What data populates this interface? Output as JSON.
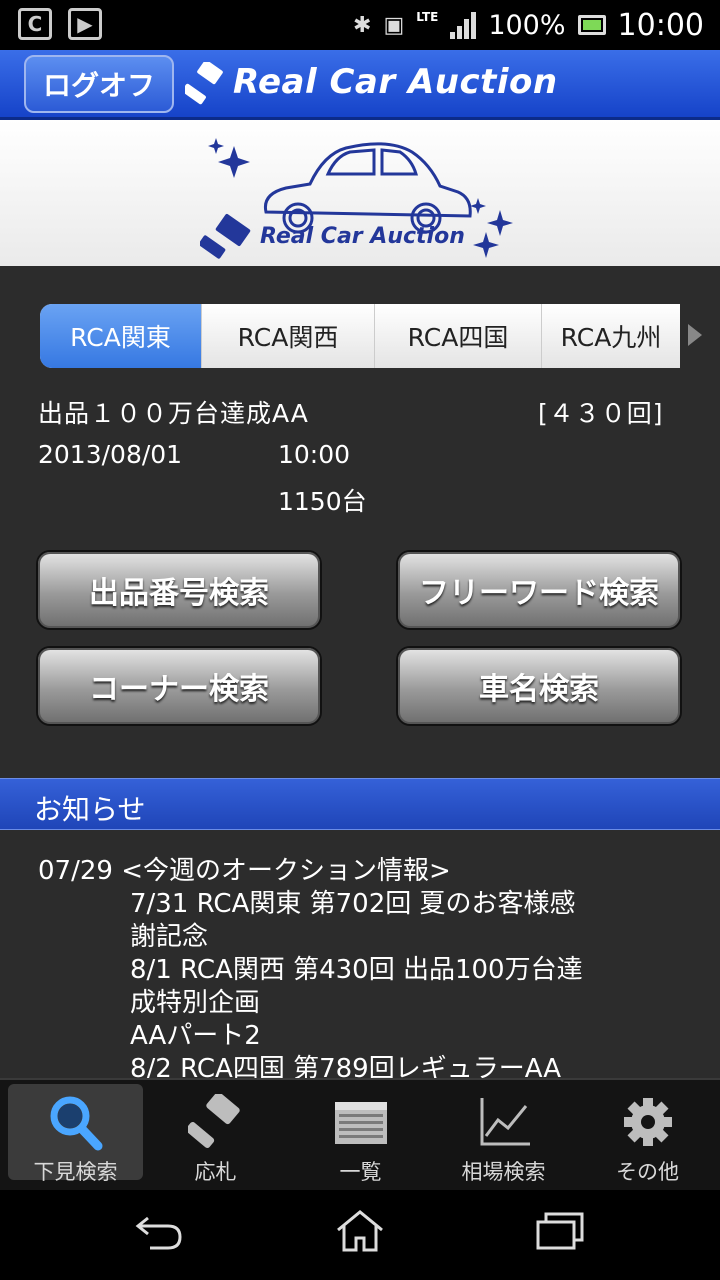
{
  "status_bar": {
    "left_icons": [
      "c-notification-icon",
      "play-store-icon"
    ],
    "right_icons": [
      "bluetooth-icon",
      "vibrate-icon",
      "lte-signal-icon",
      "battery-icon"
    ],
    "network": "LTE",
    "battery": "100%",
    "time": "10:00"
  },
  "header": {
    "logoff_label": "ログオフ",
    "title": "Real Car Auction",
    "color": "#1f4fd4"
  },
  "banner": {
    "title": "Real Car Auction"
  },
  "tabs": [
    {
      "label": "RCA関東",
      "active": true
    },
    {
      "label": "RCA関西",
      "active": false
    },
    {
      "label": "RCA四国",
      "active": false
    },
    {
      "label": "RCA九州",
      "active": false
    }
  ],
  "auction": {
    "name": "出品１００万台達成AA",
    "round": "[４３０回]",
    "date": "2013/08/01",
    "time": "10:00",
    "count": "1150台"
  },
  "search_buttons": {
    "lot_number": "出品番号検索",
    "free_word": "フリーワード検索",
    "corner": "コーナー検索",
    "car_name": "車名検索"
  },
  "news": {
    "title": "お知らせ",
    "head_line": "07/29 <今週のオークション情報>",
    "lines": [
      "7/31 RCA関東 第702回 夏のお客様感",
      "謝記念",
      "8/1 RCA関西 第430回 出品100万台達",
      "成特別企画",
      "AAパート2",
      "8/2 RCA四国 第789回レギュラーAA"
    ]
  },
  "bottom_nav": [
    {
      "label": "下見検索",
      "icon": "search-icon",
      "active": true
    },
    {
      "label": "応札",
      "icon": "gavel-icon",
      "active": false
    },
    {
      "label": "一覧",
      "icon": "list-icon",
      "active": false
    },
    {
      "label": "相場検索",
      "icon": "chart-icon",
      "active": false
    },
    {
      "label": "その他",
      "icon": "gear-icon",
      "active": false
    }
  ],
  "system_nav": [
    "back-icon",
    "home-icon",
    "recent-apps-icon"
  ]
}
